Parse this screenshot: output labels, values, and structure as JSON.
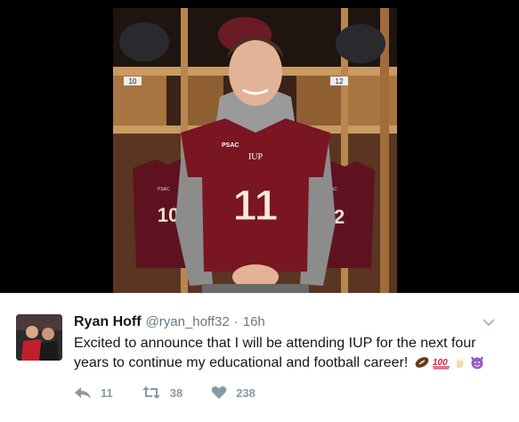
{
  "tweet": {
    "name": "Ryan Hoff",
    "handle": "@ryan_hoff32",
    "separator": "·",
    "time": "16h",
    "text": "Excited to announce that I will be attending IUP for the next four years to continue my educational and football career!",
    "emojis": [
      "football-emoji",
      "hundred-points-emoji",
      "rock-on-hand-emoji",
      "smiling-devil-emoji"
    ]
  },
  "photo": {
    "jersey_front_text": "PSAC",
    "jersey_chest_text": "IUP",
    "jersey_number": "11",
    "locker_left_number": "10",
    "locker_right_number": "12",
    "hanging_left_number": "10",
    "hanging_right_number": "12",
    "hanging_left_text": "PSAC",
    "hanging_right_text": "PSAC"
  },
  "actions": {
    "reply_count": "11",
    "retweet_count": "38",
    "like_count": "238"
  },
  "colors": {
    "maroon": "#7a1522",
    "action_gray": "#8899a6",
    "text": "#14171a",
    "secondary": "#657786"
  }
}
